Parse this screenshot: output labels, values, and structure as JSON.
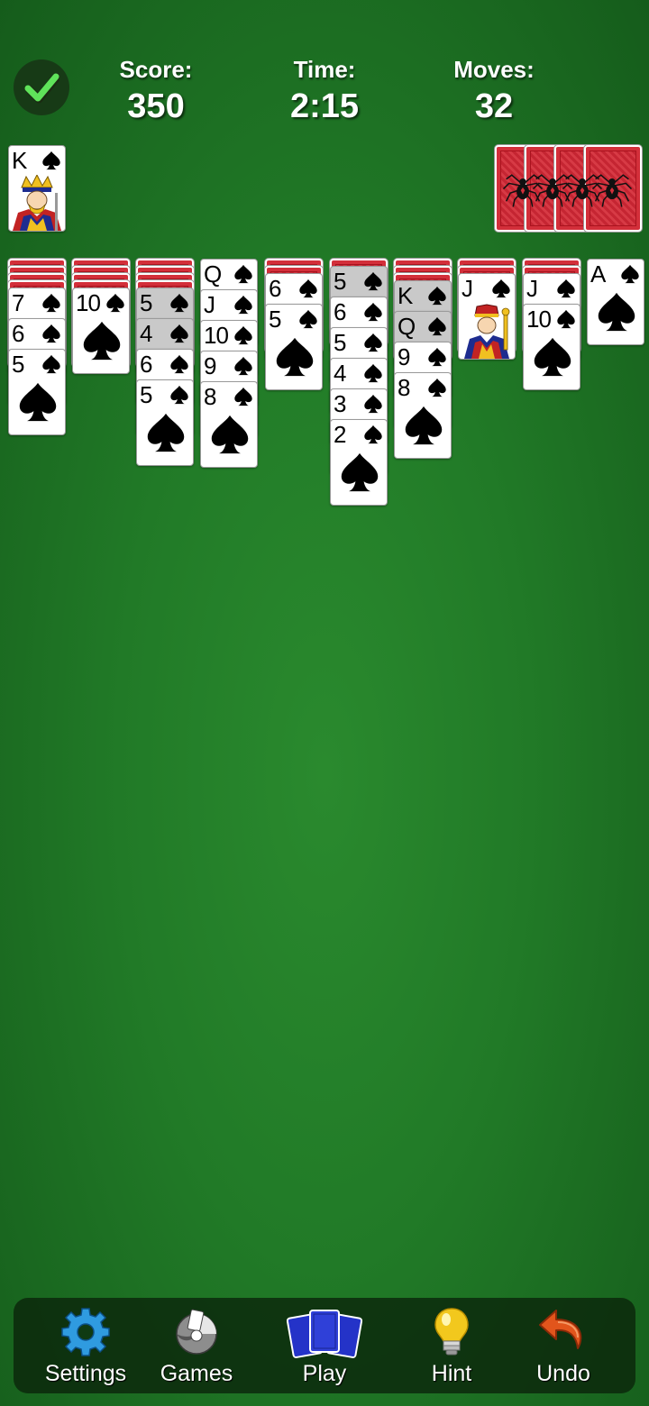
{
  "header": {
    "score_label": "Score:",
    "score_value": "350",
    "time_label": "Time:",
    "time_value": "2:15",
    "moves_label": "Moves:",
    "moves_value": "32"
  },
  "game": {
    "suit": "spades",
    "completed_foundation": {
      "rank": "K",
      "face": "king"
    },
    "stock_piles": 4,
    "tableau": [
      {
        "hidden": 4,
        "cards": [
          "7",
          "6",
          "5"
        ],
        "selected": []
      },
      {
        "hidden": 4,
        "cards": [
          "10"
        ],
        "selected": []
      },
      {
        "hidden": 4,
        "cards": [
          "5",
          "4",
          "6",
          "5"
        ],
        "selected": [
          0,
          1
        ]
      },
      {
        "hidden": 0,
        "cards": [
          "Q",
          "J",
          "10",
          "9",
          "8"
        ],
        "selected": []
      },
      {
        "hidden": 2,
        "cards": [
          "6",
          "5"
        ],
        "selected": []
      },
      {
        "hidden": 1,
        "cards": [
          "5",
          "6",
          "5",
          "4",
          "3",
          "2"
        ],
        "selected": [
          0
        ]
      },
      {
        "hidden": 3,
        "cards": [
          "K",
          "Q",
          "9",
          "8"
        ],
        "selected": [
          0,
          1
        ]
      },
      {
        "hidden": 2,
        "cards": [
          "J"
        ],
        "selected": []
      },
      {
        "hidden": 2,
        "cards": [
          "J",
          "10"
        ],
        "selected": []
      },
      {
        "hidden": 0,
        "cards": [
          "A"
        ],
        "selected": []
      }
    ]
  },
  "toolbar": {
    "settings_label": "Settings",
    "games_label": "Games",
    "play_label": "Play",
    "hint_label": "Hint",
    "undo_label": "Undo"
  },
  "colors": {
    "felt": "#217a27",
    "card_back": "#d32f3a",
    "selected_card": "#c9c9c9",
    "settings_icon": "#2f9be0",
    "play_icon": "#2433c8",
    "hint_icon": "#f2c81d",
    "undo_icon": "#e2551c"
  },
  "icons": {
    "check": "checkmark-icon",
    "settings": "gear-icon",
    "games": "cards-swirl-icon",
    "play": "card-deck-icon",
    "hint": "lightbulb-icon",
    "undo": "undo-arrow-icon"
  }
}
